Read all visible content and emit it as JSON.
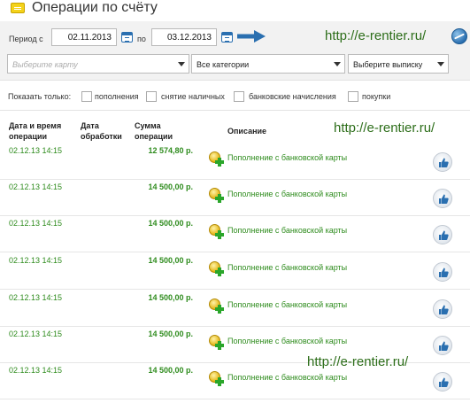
{
  "header": {
    "title": "Операции по счёту",
    "icon": "wallet-icon"
  },
  "filters": {
    "period_label": "Период с",
    "date_from": "02.11.2013",
    "to_label": "по",
    "date_to": "03.12.2013",
    "watermark_link": "http://e-rentier.ru/",
    "card_select_placeholder": "Выберите карту",
    "category_select_value": "Все категории",
    "statement_select_value": "Выберите выписку"
  },
  "show_only": {
    "label": "Показать только:",
    "options": [
      "пополнения",
      "снятие наличных",
      "банковские начисления",
      "покупки"
    ]
  },
  "table": {
    "headers": {
      "date_time": "Дата и время операции",
      "processing_date": "Дата обработки",
      "amount": "Сумма операции",
      "description": "Описание"
    },
    "overlay_links": [
      "http://e-rentier.ru/",
      "http://e-rentier.ru/"
    ],
    "rows": [
      {
        "datetime": "02.12.13 14:15",
        "processing_date": "",
        "amount": "12 574,80 р.",
        "description": "Пополнение с банковской карты"
      },
      {
        "datetime": "02.12.13 14:15",
        "processing_date": "",
        "amount": "14 500,00 р.",
        "description": "Пополнение с банковской карты"
      },
      {
        "datetime": "02.12.13 14:15",
        "processing_date": "",
        "amount": "14 500,00 р.",
        "description": "Пополнение с банковской карты"
      },
      {
        "datetime": "02.12.13 14:15",
        "processing_date": "",
        "amount": "14 500,00 р.",
        "description": "Пополнение с банковской карты"
      },
      {
        "datetime": "02.12.13 14:15",
        "processing_date": "",
        "amount": "14 500,00 р.",
        "description": "Пополнение с банковской карты"
      },
      {
        "datetime": "02.12.13 14:15",
        "processing_date": "",
        "amount": "14 500,00 р.",
        "description": "Пополнение с банковской карты"
      },
      {
        "datetime": "02.12.13 14:15",
        "processing_date": "",
        "amount": "14 500,00 р.",
        "description": "Пополнение с банковской карты"
      }
    ]
  },
  "colors": {
    "accent_green": "#2f8c1e",
    "link_green": "#2d6e1a",
    "accent_blue": "#2a6fb0",
    "panel_bg": "#f2f2f2"
  },
  "icons": {
    "calendar": "calendar-icon",
    "submit_arrow": "arrow-right-icon",
    "globe": "globe-icon",
    "operation": "coin-plus-icon",
    "like": "thumbs-up-icon"
  }
}
